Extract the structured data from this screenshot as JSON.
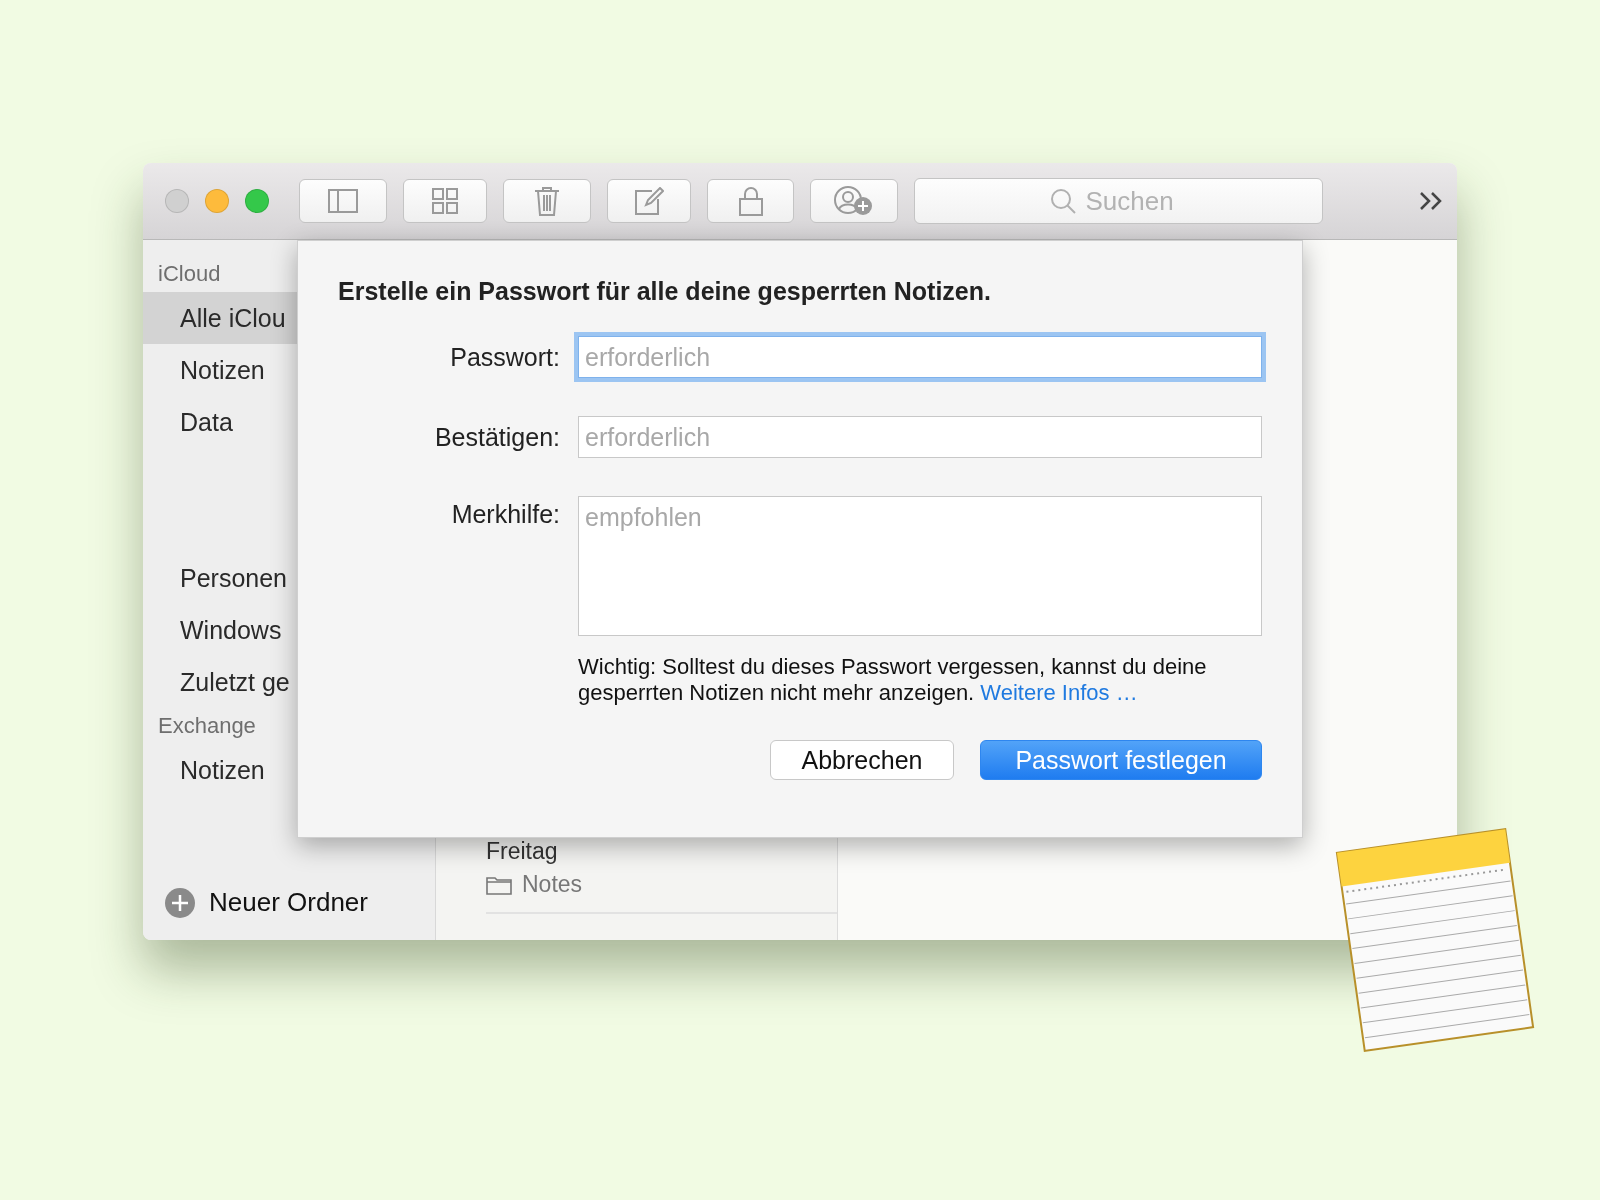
{
  "toolbar": {
    "search": {
      "placeholder": "Suchen"
    }
  },
  "sidebar": {
    "sections": [
      {
        "title": "iCloud",
        "groups": [
          [
            {
              "label": "Alle iClou",
              "selected": true
            },
            {
              "label": "Notizen",
              "selected": false
            },
            {
              "label": "Data",
              "selected": false
            }
          ],
          [
            {
              "label": "Personen",
              "selected": false
            },
            {
              "label": "Windows",
              "selected": false
            },
            {
              "label": "Zuletzt ge",
              "selected": false
            }
          ]
        ]
      },
      {
        "title": "Exchange",
        "groups": [
          [
            {
              "label": "Notizen",
              "selected": false
            }
          ]
        ]
      }
    ],
    "new_folder": "Neuer Ordner"
  },
  "note_list": {
    "items": [
      {
        "date": "Freitag",
        "folder": "Notes"
      }
    ]
  },
  "dialog": {
    "title": "Erstelle ein Passwort für alle deine gesperrten Notizen.",
    "fields": [
      {
        "label": "Passwort:",
        "placeholder": "erforderlich",
        "kind": "single",
        "focused": true
      },
      {
        "label": "Bestätigen:",
        "placeholder": "erforderlich",
        "kind": "single",
        "focused": false
      },
      {
        "label": "Merkhilfe:",
        "placeholder": "empfohlen",
        "kind": "multi",
        "focused": false
      }
    ],
    "warning": "Wichtig: Solltest du dieses Passwort vergessen, kannst du deine gesperrten Notizen nicht mehr anzeigen.",
    "link": "Weitere Infos …",
    "buttons": [
      {
        "label": "Abbrechen",
        "primary": false
      },
      {
        "label": "Passwort festlegen",
        "primary": true
      }
    ]
  }
}
